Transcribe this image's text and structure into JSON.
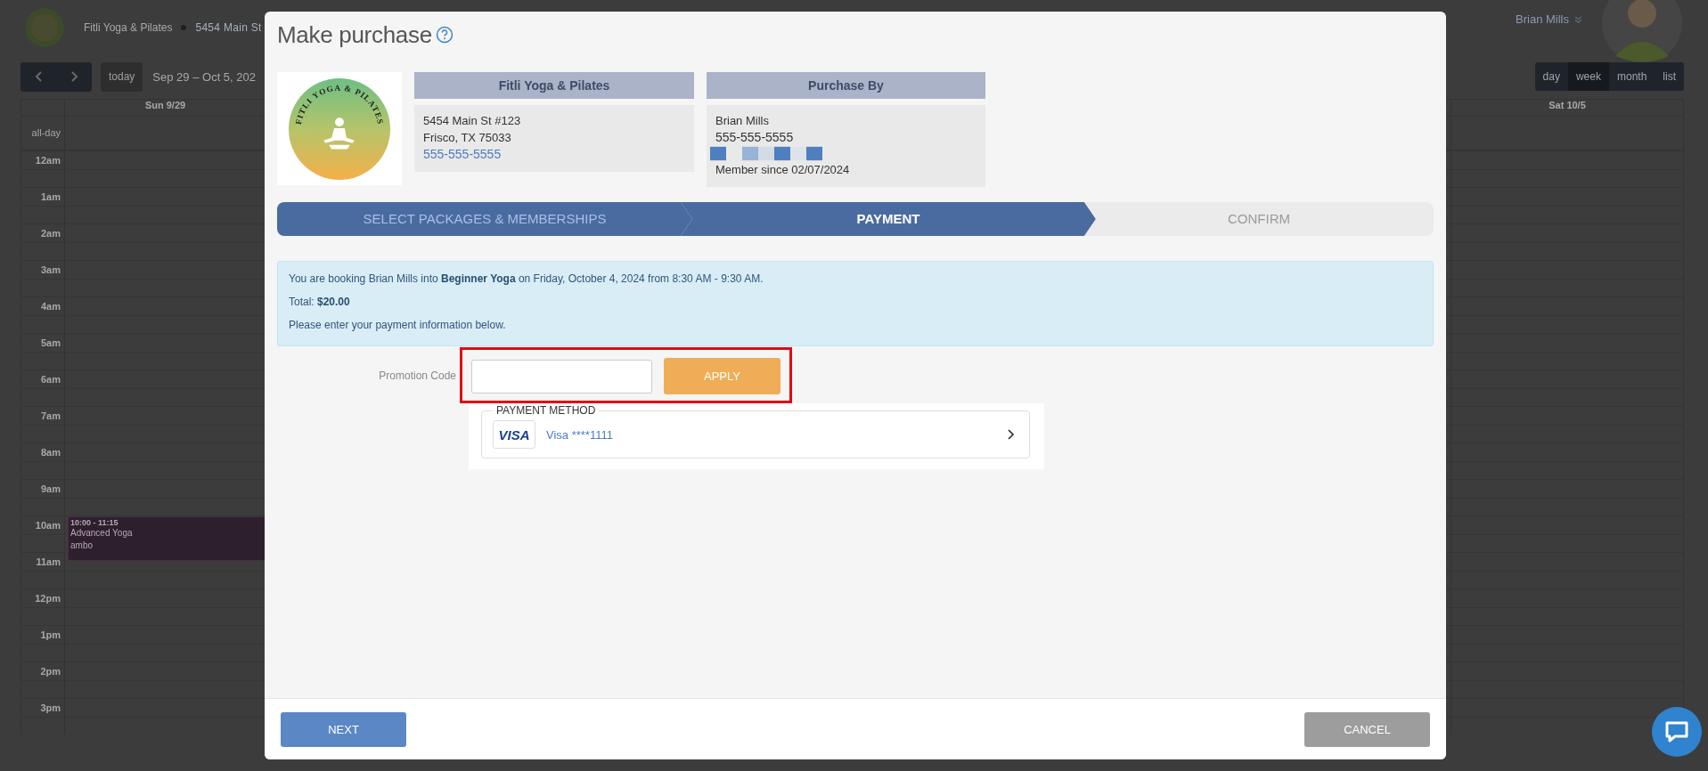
{
  "background": {
    "studio_name": "Fitli Yoga & Pilates",
    "address": "5454 Main St",
    "today": "today",
    "date_range": "Sep 29 – Oct 5, 202",
    "user_name": "Brian Mills",
    "views": [
      {
        "label": "day",
        "selected": false
      },
      {
        "label": "week",
        "selected": true
      },
      {
        "label": "month",
        "selected": false
      },
      {
        "label": "list",
        "selected": false
      }
    ],
    "calendar": {
      "columns": [
        "Sun 9/29",
        "Sat 10/5"
      ],
      "all_day_label": "all-day",
      "hours": [
        {
          "label": "12am"
        },
        {
          "label": "1am"
        },
        {
          "label": "2am"
        },
        {
          "label": "3am"
        },
        {
          "label": "4am"
        },
        {
          "label": "5am"
        },
        {
          "label": "6am"
        },
        {
          "label": "7am"
        },
        {
          "label": "8am"
        },
        {
          "label": "9am"
        },
        {
          "label": "10am",
          "events": [
            {
              "time": "10:00 - 11:15",
              "title": "Advanced Yoga",
              "detail": "ambo"
            }
          ]
        },
        {
          "label": "11am"
        },
        {
          "label": "12pm"
        },
        {
          "label": "1pm"
        },
        {
          "label": "2pm"
        },
        {
          "label": "3pm"
        }
      ]
    }
  },
  "modal": {
    "title": "Make purchase",
    "logo_text": "FITLI YOGA & PILATES",
    "studio": {
      "heading": "Fitli Yoga & Pilates",
      "address_line1": "5454 Main St #123",
      "address_line2": "Frisco, TX 75033",
      "phone": "555-555-5555"
    },
    "purchaser": {
      "heading": "Purchase By",
      "name": "Brian Mills",
      "phone": "555-555-5555",
      "member_since": "Member since 02/07/2024"
    },
    "steps": [
      {
        "label": "SELECT PACKAGES & MEMBERSHIPS",
        "selected": false,
        "completed": true
      },
      {
        "label": "PAYMENT",
        "selected": true,
        "completed": false
      },
      {
        "label": "CONFIRM",
        "selected": false,
        "completed": false
      }
    ],
    "booking": {
      "sentence": "You are booking Brian Mills into **Beginner Yoga** on Friday, October 4, 2024 from 8:30 AM - 9:30 AM.",
      "total": "Total: **$20.00**",
      "instructions": "Please enter your payment information below."
    },
    "promo": {
      "label": "Promotion Code",
      "button": "APPLY",
      "highlighted": true
    },
    "payment_method": {
      "legend": "PAYMENT METHOD",
      "card_logo": "VISA",
      "card_label": "Visa ****1111"
    },
    "buttons": {
      "next": "NEXT",
      "cancel": "CANCEL"
    }
  }
}
